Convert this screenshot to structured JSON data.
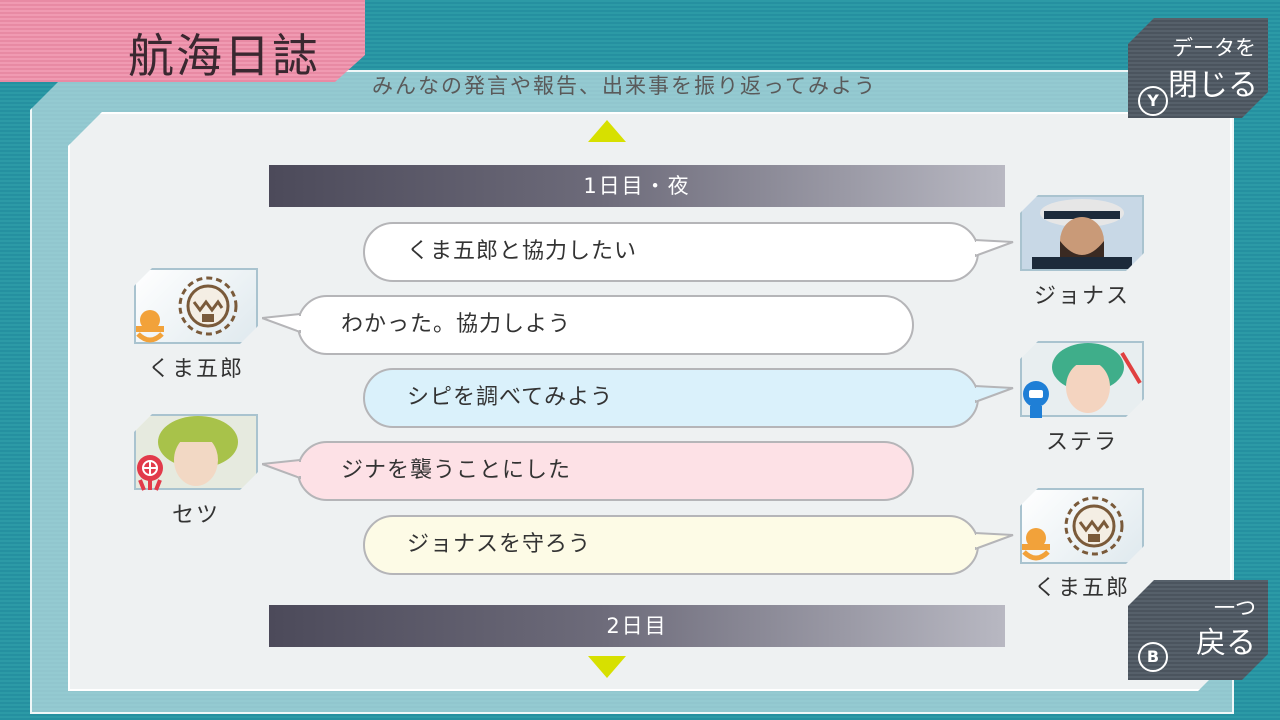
{
  "header": {
    "title": "航海日誌",
    "subtitle": "みんなの発言や報告、出来事を振り返ってみよう"
  },
  "buttons": {
    "close": {
      "line1": "データを",
      "line2": "閉じる",
      "key": "Y"
    },
    "back": {
      "line1": "一つ",
      "line2": "戻る",
      "key": "B"
    }
  },
  "days": {
    "current": "1日目・夜",
    "next": "2日目"
  },
  "log": [
    {
      "speaker": "ジョナス",
      "text": "くま五郎と協力したい",
      "side": "right",
      "style": "white"
    },
    {
      "speaker": "くま五郎",
      "text": "わかった。協力しよう",
      "side": "left",
      "style": "white"
    },
    {
      "speaker": "ステラ",
      "text": "シピを調べてみよう",
      "side": "right",
      "style": "blue"
    },
    {
      "speaker": "セツ",
      "text": "ジナを襲うことにした",
      "side": "left",
      "style": "pink"
    },
    {
      "speaker": "くま五郎",
      "text": "ジョナスを守ろう",
      "side": "right",
      "style": "cream"
    }
  ],
  "colors": {
    "accent_arrow": "#d7e000",
    "title_pink": "#f09ab2",
    "background_teal": "#2c9aa6",
    "bubble_blue": "#daf1fb",
    "bubble_pink": "#fde1e6",
    "bubble_cream": "#fdfbe6"
  }
}
